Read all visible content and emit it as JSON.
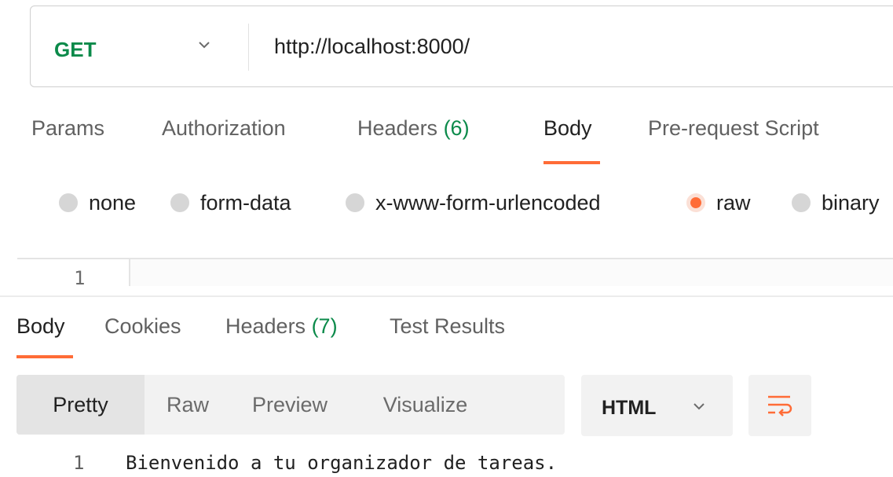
{
  "request": {
    "method": "GET",
    "url": "http://localhost:8000/"
  },
  "request_tabs": [
    {
      "label": "Params",
      "count": ""
    },
    {
      "label": "Authorization",
      "count": ""
    },
    {
      "label": "Headers ",
      "count": "(6)"
    },
    {
      "label": "Body",
      "count": ""
    },
    {
      "label": "Pre-request Script",
      "count": ""
    }
  ],
  "body_types": [
    "none",
    "form-data",
    "x-www-form-urlencoded",
    "raw",
    "binary"
  ],
  "request_editor": {
    "line_number": "1"
  },
  "response_tabs": [
    {
      "label": "Body",
      "count": ""
    },
    {
      "label": "Cookies",
      "count": ""
    },
    {
      "label": "Headers ",
      "count": "(7)"
    },
    {
      "label": "Test Results",
      "count": ""
    }
  ],
  "response_views": [
    "Pretty",
    "Raw",
    "Preview",
    "Visualize"
  ],
  "response_format": "HTML",
  "response_body": {
    "line_number": "1",
    "text": "Bienvenido a tu organizador de tareas."
  },
  "colors": {
    "accent": "#ff6c37",
    "method_green": "#0b8a4a"
  },
  "icons": {
    "method_dropdown": "chevron-down-icon",
    "format_dropdown": "chevron-down-icon",
    "wrap": "wrap-lines-icon"
  }
}
